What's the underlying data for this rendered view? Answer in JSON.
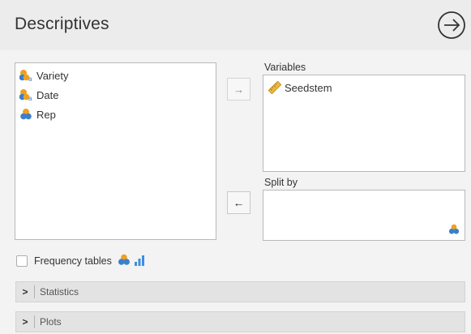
{
  "window": {
    "title": "Descriptives"
  },
  "available_variables": [
    {
      "name": "Variety",
      "type": "nominal-text"
    },
    {
      "name": "Date",
      "type": "nominal-text"
    },
    {
      "name": "Rep",
      "type": "nominal"
    }
  ],
  "targets": {
    "variables": {
      "label": "Variables",
      "items": [
        {
          "name": "Seedstem",
          "type": "continuous"
        }
      ]
    },
    "split_by": {
      "label": "Split by",
      "items": []
    }
  },
  "buttons": {
    "move_right": "→",
    "move_left": "←"
  },
  "options": {
    "frequency_tables": {
      "label": "Frequency tables",
      "checked": false
    }
  },
  "sections": [
    {
      "label": "Statistics",
      "chevron": ">"
    },
    {
      "label": "Plots",
      "chevron": ">"
    }
  ],
  "colors": {
    "nominal_orange": "#f0a020",
    "nominal_blue": "#3d7fc8",
    "continuous_gold": "#e8b840",
    "bar_blue": "#3c8fe0"
  }
}
